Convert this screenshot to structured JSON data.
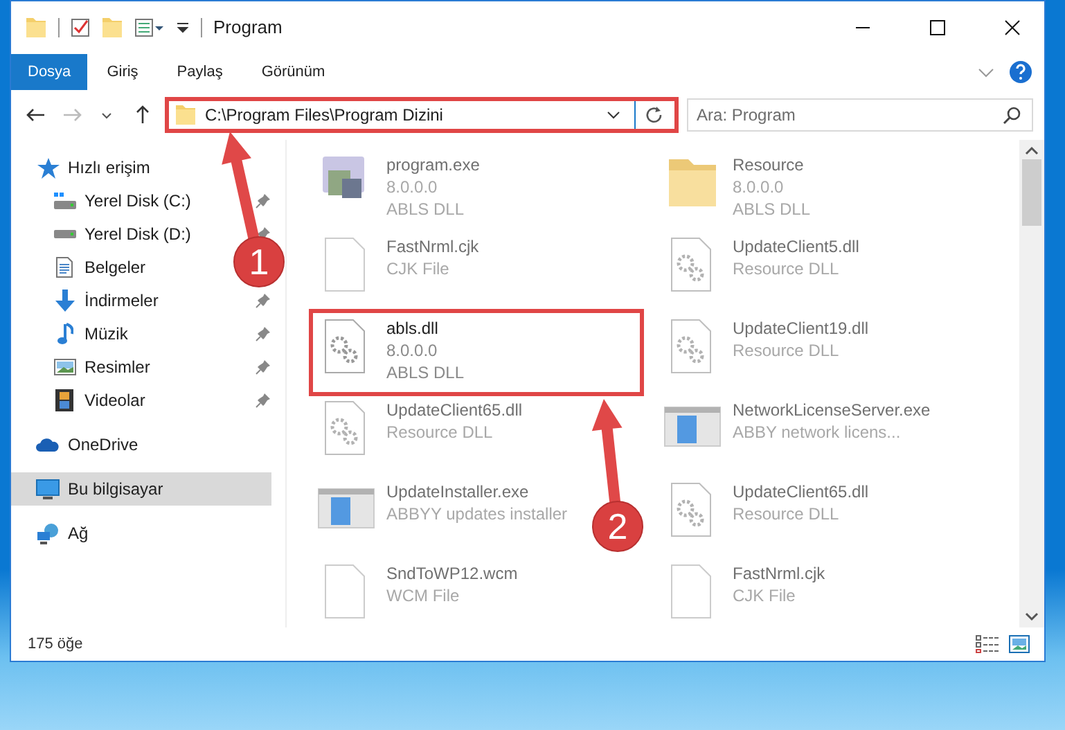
{
  "window": {
    "title": "Program"
  },
  "ribbon_tabs": [
    {
      "label": "Dosya",
      "selected": true
    },
    {
      "label": "Giriş",
      "selected": false
    },
    {
      "label": "Paylaş",
      "selected": false
    },
    {
      "label": "Görünüm",
      "selected": false
    }
  ],
  "address": {
    "path": "C:\\Program Files\\Program Dizini",
    "highlighted": true
  },
  "search": {
    "placeholder": "Ara: Program"
  },
  "sidebar": {
    "items": [
      {
        "label": "Hızlı erişim",
        "kind": "star",
        "selected": false,
        "children": [
          {
            "label": "Yerel Disk (C:)",
            "kind": "drive-c",
            "pinned": true,
            "selected": false
          },
          {
            "label": "Yerel Disk (D:)",
            "kind": "drive",
            "pinned": true,
            "selected": false
          },
          {
            "label": "Belgeler",
            "kind": "doc",
            "pinned": false,
            "selected": false
          },
          {
            "label": "İndirmeler",
            "kind": "download",
            "pinned": true,
            "selected": false
          },
          {
            "label": "Müzik",
            "kind": "music",
            "pinned": true,
            "selected": false
          },
          {
            "label": "Resimler",
            "kind": "pictures",
            "pinned": true,
            "selected": false
          },
          {
            "label": "Videolar",
            "kind": "video",
            "pinned": true,
            "selected": false
          }
        ]
      },
      {
        "label": "OneDrive",
        "kind": "cloud",
        "selected": false
      },
      {
        "label": "Bu bilgisayar",
        "kind": "pc",
        "selected": true
      },
      {
        "label": "Ağ",
        "kind": "network",
        "selected": false
      }
    ]
  },
  "files": [
    {
      "name": "program.exe",
      "details": [
        "8.0.0.0",
        "ABLS DLL"
      ],
      "kind": "exe",
      "faded": true,
      "highlighted": false
    },
    {
      "name": "Resource",
      "details": [
        "8.0.0.0",
        "ABLS DLL"
      ],
      "kind": "folder",
      "faded": true,
      "highlighted": false
    },
    {
      "name": "FastNrml.cjk",
      "details": [
        "CJK File"
      ],
      "kind": "blank",
      "faded": true,
      "highlighted": false
    },
    {
      "name": "UpdateClient5.dll",
      "details": [
        "Resource DLL"
      ],
      "kind": "dll",
      "faded": true,
      "highlighted": false
    },
    {
      "name": "abls.dll",
      "details": [
        "8.0.0.0",
        "ABLS DLL"
      ],
      "kind": "dll",
      "faded": false,
      "highlighted": true
    },
    {
      "name": "UpdateClient19.dll",
      "details": [
        "Resource DLL"
      ],
      "kind": "dll",
      "faded": true,
      "highlighted": false
    },
    {
      "name": "UpdateClient65.dll",
      "details": [
        "Resource DLL"
      ],
      "kind": "dll",
      "faded": true,
      "highlighted": false
    },
    {
      "name": "NetworkLicenseServer.exe",
      "details": [
        "ABBY network licens..."
      ],
      "kind": "app",
      "faded": true,
      "highlighted": false
    },
    {
      "name": "UpdateInstaller.exe",
      "details": [
        "ABBYY updates installer"
      ],
      "kind": "app",
      "faded": true,
      "highlighted": false
    },
    {
      "name": "UpdateClient65.dll",
      "details": [
        "Resource DLL"
      ],
      "kind": "dll",
      "faded": true,
      "highlighted": false
    },
    {
      "name": "SndToWP12.wcm",
      "details": [
        "WCM File"
      ],
      "kind": "blank",
      "faded": true,
      "highlighted": false
    },
    {
      "name": "FastNrml.cjk",
      "details": [
        "CJK File"
      ],
      "kind": "blank",
      "faded": true,
      "highlighted": false
    }
  ],
  "status_bar": {
    "count": "175 öğe"
  },
  "annotations": [
    {
      "number": "1"
    },
    {
      "number": "2"
    }
  ]
}
